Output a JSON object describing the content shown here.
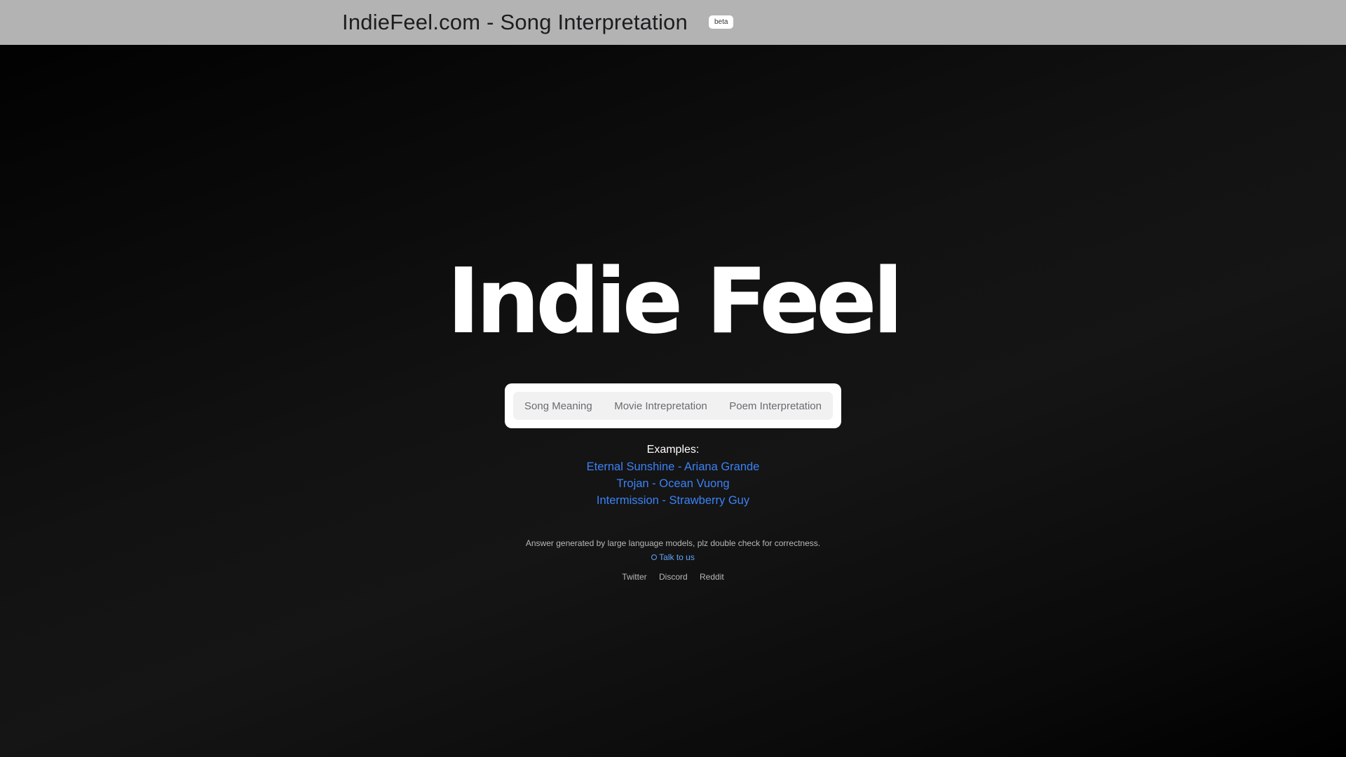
{
  "header": {
    "title": "IndieFeel.com - Song Interpretation",
    "badge": "beta"
  },
  "hero": {
    "title": "Indie Feel"
  },
  "tabs": [
    {
      "label": "Song Meaning"
    },
    {
      "label": "Movie Intrepretation"
    },
    {
      "label": "Poem Interpretation"
    }
  ],
  "examples": {
    "heading": "Examples:",
    "items": [
      {
        "label": "Eternal Sunshine - Ariana Grande"
      },
      {
        "label": "Trojan - Ocean Vuong"
      },
      {
        "label": "Intermission - Strawberry Guy"
      }
    ]
  },
  "footer": {
    "disclaimer": "Answer generated by large language models, plz double check for correctness.",
    "talk_label": "Talk to us",
    "talk_icon": "chat-circle-icon",
    "social": [
      {
        "label": "Twitter"
      },
      {
        "label": "Discord"
      },
      {
        "label": "Reddit"
      }
    ]
  },
  "colors": {
    "accent_link": "#3b82f6",
    "header_bg": "#b3b3b3",
    "page_bg": "#0d0d0d"
  }
}
